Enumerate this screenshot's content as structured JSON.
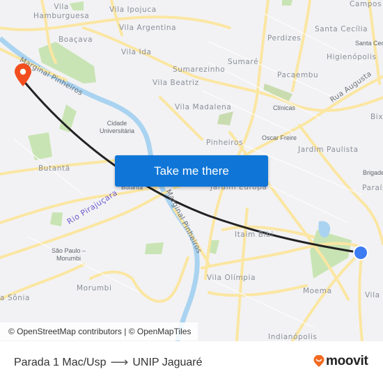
{
  "map": {
    "labels": {
      "vila_hamburguesa": "Vila\nHamburguesa",
      "vila_ipojuca": "Vila Ipojuca",
      "vila_argentina": "Vila Argentina",
      "boacava": "Boaçava",
      "vila_ida": "Vila Ida",
      "sumarezinho": "Sumarezinho",
      "vila_beatriz": "Vila Beatriz",
      "sumare": "Sumaré",
      "perdizes": "Perdizes",
      "pacaembu": "Pacaembu",
      "campos": "Campos",
      "santa_cecilia": "Santa Cecília",
      "santa_cecilia_station": "Santa Cec",
      "higienopolis": "Higienópolis",
      "vila_madalena": "Vila Madalena",
      "clinicas": "Clínicas",
      "rua_augusta": "Rua Augusta",
      "bixiga": "Bixi",
      "cidade_universitaria": "Cidade\nUniversitária",
      "pinheiros": "Pinheiros",
      "oscar_freire": "Oscar Freire",
      "jardim_paulista": "Jardim Paulista",
      "brigadeiro": "Brigade",
      "paraiso": "Paraís",
      "butanta": "Butantã",
      "butanta_station": "Butantã",
      "jardim_europa": "Jardim Europa",
      "marginal_pinheiros_top": "Marginal Pinheiros",
      "marginal_pinheiros_mid": "Marginal Pinheiros",
      "rio_pirajucara": "Rio Pirajuçara",
      "sao_paulo_morumbi": "São Paulo –\nMorumbi",
      "itaim_bibi": "Itaim Bibi",
      "vila_olimpia": "Vila Olímpia",
      "morumbi": "Morumbi",
      "moema": "Moema",
      "vila_sonia": "a Sônia",
      "vila_c": "Vila C",
      "indianopolis": "Indianópolis"
    },
    "colors": {
      "origin_pin": "#f24e1e",
      "destination_dot": "#3d7cf2",
      "route_line": "#222222",
      "roads": "#fbe6a2",
      "water": "#a9d3f0",
      "park": "#c9e4b4"
    }
  },
  "cta": {
    "label": "Take me there"
  },
  "attribution": {
    "text": "© OpenStreetMap contributors | © OpenMapTiles"
  },
  "footer": {
    "origin": "Parada 1 Mac/Usp",
    "arrow": "⟶",
    "destination": "UNIP Jaguaré",
    "brand": "moovit",
    "brand_color": "#f26a21"
  }
}
